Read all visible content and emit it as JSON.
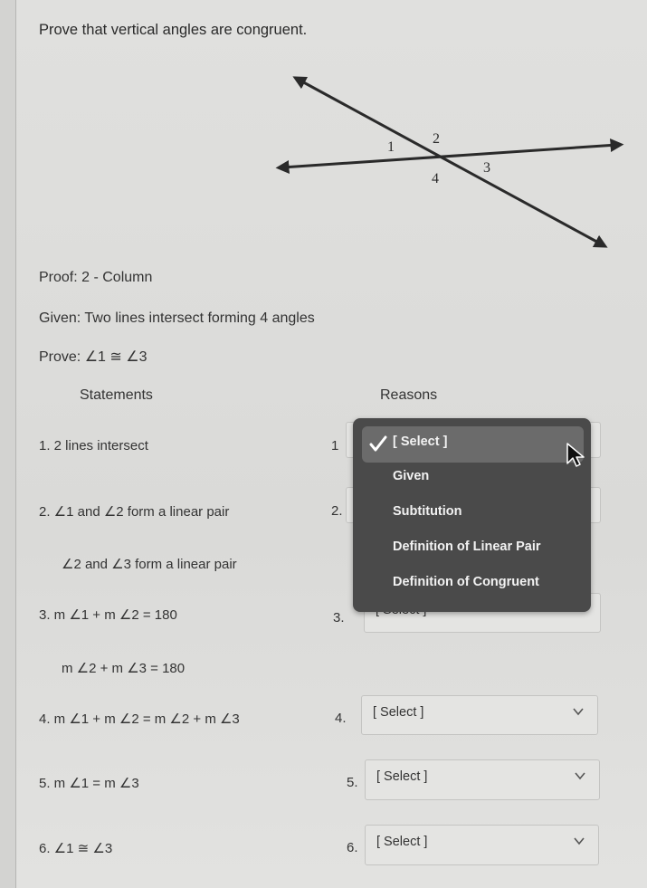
{
  "question": {
    "title": "Prove that vertical angles are congruent.",
    "diagram": {
      "labels": [
        "1",
        "2",
        "3",
        "4"
      ],
      "description": "Two lines intersecting forming 4 angles"
    },
    "proof_type": "Proof: 2 - Column",
    "given": "Given: Two lines intersect forming 4 angles",
    "prove": "Prove: ∠1 ≅ ∠3"
  },
  "table": {
    "headers": {
      "statements": "Statements",
      "reasons": "Reasons"
    },
    "rows": [
      {
        "statement": "1.  2 lines intersect",
        "reason_number": "1",
        "selected": "[ Select ]"
      },
      {
        "statement": "2.  ∠1 and ∠2 form a linear pair",
        "statement_line2": "∠2 and ∠3 form a linear pair",
        "reason_number": "2.",
        "selected": "[ Select ]"
      },
      {
        "statement": "3.  m ∠1 + m ∠2 = 180",
        "statement_line2": "m ∠2 + m ∠3 = 180",
        "reason_number": "3.",
        "selected": "[ Select ]"
      },
      {
        "statement": "4.  m ∠1 + m ∠2 = m ∠2 + m ∠3",
        "reason_number": "4.",
        "selected": "[ Select ]"
      },
      {
        "statement": "5.  m ∠1 = m ∠3",
        "reason_number": "5.",
        "selected": "[ Select ]"
      },
      {
        "statement": "6.  ∠1 ≅ ∠3",
        "reason_number": "6.",
        "selected": "[ Select ]"
      }
    ]
  },
  "dropdown": {
    "open_for_row": 1,
    "options": [
      {
        "label": "[ Select ]",
        "checked": true,
        "highlighted": true
      },
      {
        "label": "Given",
        "checked": false
      },
      {
        "label": "Subtitution",
        "checked": false
      },
      {
        "label": "Definition of Linear Pair",
        "checked": false
      },
      {
        "label": "Definition of Congruent",
        "checked": false
      }
    ]
  },
  "icons": {
    "check": "check-icon",
    "chevron": "chevron-down-icon",
    "cursor": "mouse-pointer-icon"
  }
}
